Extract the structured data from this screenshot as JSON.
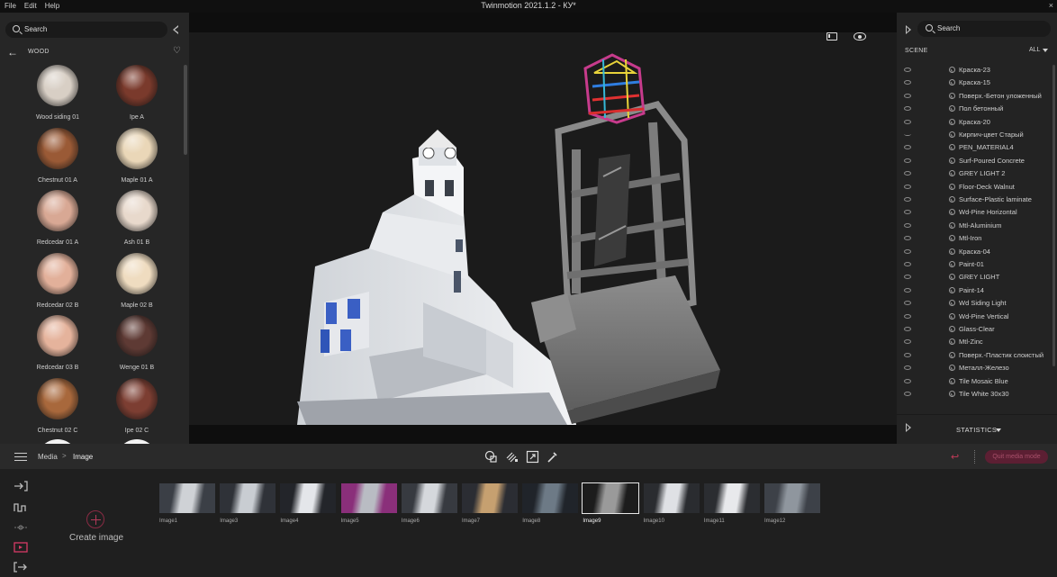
{
  "window": {
    "title": "Twinmotion 2021.1.2 - КУ*",
    "menu": [
      "File",
      "Edit",
      "Help"
    ],
    "close_glyph": "×"
  },
  "left_panel": {
    "search_placeholder": "Search",
    "category": "WOOD",
    "materials": [
      {
        "label": "Wood siding 01",
        "color": "#d8cfc5"
      },
      {
        "label": "Ipe A",
        "color": "#7a3a2c"
      },
      {
        "label": "Chestnut 01 A",
        "color": "#9a5a36"
      },
      {
        "label": "Maple 01 A",
        "color": "#ead7b8"
      },
      {
        "label": "Redcedar 01 A",
        "color": "#d8a894"
      },
      {
        "label": "Ash 01 B",
        "color": "#e8d9cc"
      },
      {
        "label": "Redcedar 02 B",
        "color": "#e2b09a"
      },
      {
        "label": "Maple 02 B",
        "color": "#efdcc0"
      },
      {
        "label": "Redcedar 03 B",
        "color": "#e5b39c"
      },
      {
        "label": "Wenge 01 B",
        "color": "#5e3a34"
      },
      {
        "label": "Chestnut 02 C",
        "color": "#a8683c"
      },
      {
        "label": "Ipe 02 C",
        "color": "#7c3e32"
      }
    ]
  },
  "right_panel": {
    "search_placeholder": "Search",
    "section": "SCENE",
    "filter": "ALL",
    "items": [
      {
        "name": "Краска-23",
        "visible": true
      },
      {
        "name": "Краска-15",
        "visible": true
      },
      {
        "name": "Поверх.-Бетон уложенный",
        "visible": true
      },
      {
        "name": "Пол бетонный",
        "visible": true
      },
      {
        "name": "Краска-20",
        "visible": true
      },
      {
        "name": "Кирпич-цвет Старый",
        "visible": false
      },
      {
        "name": "PEN_MATERIAL4",
        "visible": true
      },
      {
        "name": "Surf-Poured Concrete",
        "visible": true
      },
      {
        "name": "GREY LIGHT  2",
        "visible": true
      },
      {
        "name": "Floor-Deck Walnut",
        "visible": true
      },
      {
        "name": "Surface-Plastic laminate",
        "visible": true
      },
      {
        "name": "Wd-Pine Horizontal",
        "visible": true
      },
      {
        "name": "Mtl-Aluminium",
        "visible": true
      },
      {
        "name": "Mtl-Iron",
        "visible": true
      },
      {
        "name": "Краска-04",
        "visible": true
      },
      {
        "name": "Paint-01",
        "visible": true
      },
      {
        "name": "GREY LIGHT",
        "visible": true
      },
      {
        "name": "Paint-14",
        "visible": true
      },
      {
        "name": "Wd Siding Light",
        "visible": true
      },
      {
        "name": "Wd-Pine Vertical",
        "visible": true
      },
      {
        "name": "Glass-Clear",
        "visible": true
      },
      {
        "name": "Mtl-Zinc",
        "visible": true
      },
      {
        "name": "Поверх.-Пластик слоистый",
        "visible": true
      },
      {
        "name": "Металл-Железо",
        "visible": true
      },
      {
        "name": "Tile Mosaic Blue",
        "visible": true
      },
      {
        "name": "Tile White 30x30",
        "visible": true
      }
    ],
    "statistics_label": "STATISTICS"
  },
  "toolbar": {
    "breadcrumb": [
      "Media",
      "Image"
    ],
    "separator": ">",
    "quit_label": "Quit media mode",
    "undo_glyph": "↩"
  },
  "media": {
    "create_label": "Create image",
    "selected": "Image9",
    "thumbnails": [
      "Image1",
      "Image3",
      "Image4",
      "Image5",
      "Image6",
      "Image7",
      "Image8",
      "Image9",
      "Image10",
      "Image11",
      "Image12"
    ]
  },
  "icons": {
    "left_search": "search-icon",
    "back": "arrow-left-icon",
    "favorite": "heart-icon",
    "viewport_frame": "frame-icon",
    "viewport_eye": "eye-icon",
    "menu": "hamburger-icon"
  },
  "colors": {
    "accent": "#c23a58",
    "quit_bg": "#5c1f33"
  }
}
